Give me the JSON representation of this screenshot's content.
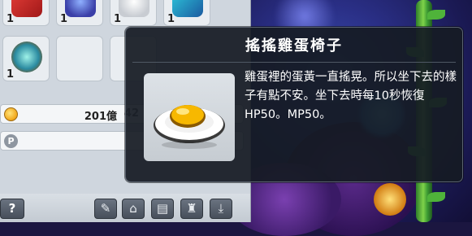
{
  "inventory": {
    "slots": [
      {
        "qty": "1",
        "icon": "red-gift-boxes-icon"
      },
      {
        "qty": "1",
        "icon": "crystal-tree-icon"
      },
      {
        "qty": "1",
        "icon": "white-glove-icon"
      },
      {
        "qty": "1",
        "icon": "blue-snowman-icon"
      },
      {
        "qty": "1",
        "icon": "jeweled-ornament-icon"
      },
      {
        "qty": "",
        "icon": ""
      },
      {
        "qty": "",
        "icon": ""
      }
    ],
    "meso_amount": "201億",
    "meso_truncated": "42"
  },
  "tooltip": {
    "title": "搖搖雞蛋椅子",
    "description": "雞蛋裡的蛋黃一直搖晃。所以坐下去的樣子有點不安。坐下去時每10秒恢復HP50。MP50。",
    "item_icon": "fried-egg-icon"
  },
  "toolbar": {
    "help_label": "?",
    "buttons": [
      "wand-icon",
      "shop-icon",
      "storage-icon",
      "shirt-icon",
      "download-icon"
    ]
  },
  "colors": {
    "tooltip_bg": "#161b24",
    "inventory_bg": "#cfd6de",
    "coin_gold": "#f1a619"
  }
}
